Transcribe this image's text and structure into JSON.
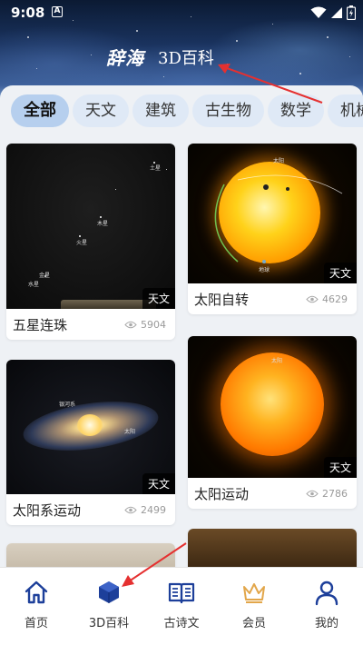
{
  "status": {
    "time": "9:08",
    "a_label": "A"
  },
  "header": {
    "brand_logo": "辞海",
    "title": "3D百科"
  },
  "tabs": [
    "全部",
    "天文",
    "建筑",
    "古生物",
    "数学",
    "机械"
  ],
  "cards": [
    {
      "title": "五星连珠",
      "views": "5904",
      "tag": "天文",
      "labels": [
        "土星",
        "木星",
        "火星",
        "金星",
        "水星"
      ]
    },
    {
      "title": "太阳自转",
      "views": "4629",
      "tag": "天文",
      "labels": [
        "太阳",
        "地球"
      ]
    },
    {
      "title": "太阳系运动",
      "views": "2499",
      "tag": "天文",
      "labels": [
        "银河系",
        "太阳"
      ]
    },
    {
      "title": "太阳运动",
      "views": "2786",
      "tag": "天文",
      "labels": [
        "太阳"
      ]
    }
  ],
  "nav": [
    {
      "label": "首页",
      "icon": "home-icon"
    },
    {
      "label": "3D百科",
      "icon": "cube-icon"
    },
    {
      "label": "古诗文",
      "icon": "book-icon"
    },
    {
      "label": "会员",
      "icon": "crown-icon"
    },
    {
      "label": "我的",
      "icon": "person-icon"
    }
  ],
  "colors": {
    "accent": "#1d3f9a",
    "tab_active": "#b6cfee",
    "tab_bg": "#dfe9f6",
    "arrow": "#e53030"
  }
}
